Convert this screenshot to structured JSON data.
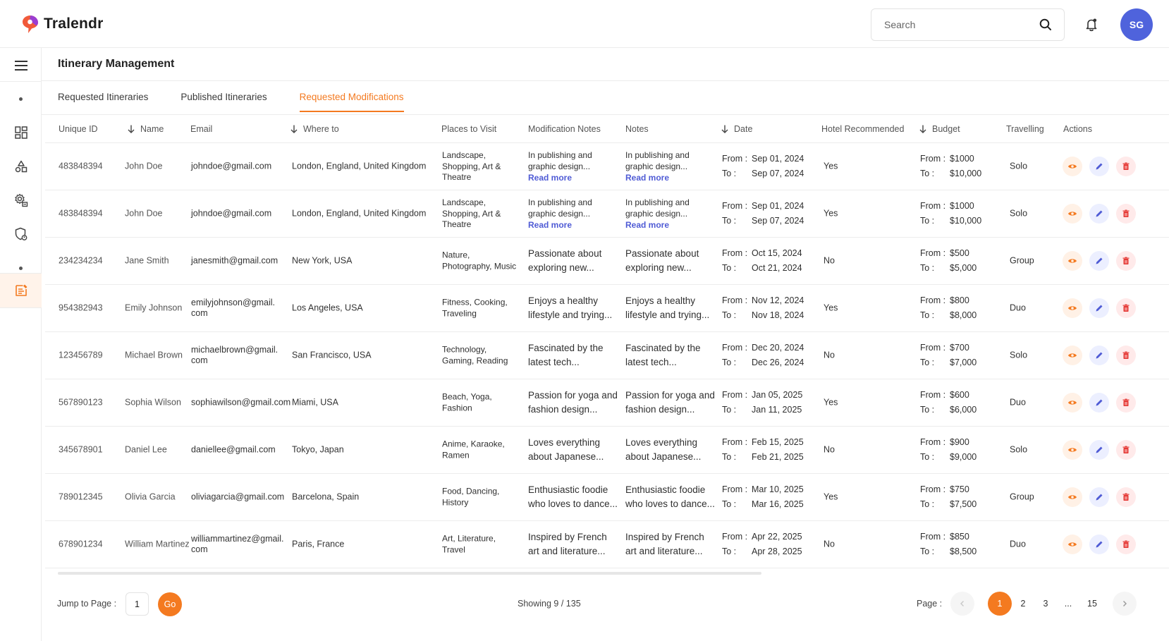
{
  "app": {
    "brand": "Tralendr"
  },
  "header": {
    "search_placeholder": "Search",
    "avatar_initials": "SG"
  },
  "page": {
    "title": "Itinerary Management",
    "tabs": [
      {
        "label": "Requested Itineraries",
        "active": false
      },
      {
        "label": "Published Itineraries",
        "active": false
      },
      {
        "label": "Requested Modifications",
        "active": true
      }
    ]
  },
  "sidebar": {
    "items": [
      {
        "icon": "menu-icon"
      },
      {
        "icon": "dot-icon"
      },
      {
        "icon": "dashboard-icon"
      },
      {
        "icon": "shapes-icon"
      },
      {
        "icon": "settings-icon"
      },
      {
        "icon": "shield-user-icon"
      },
      {
        "icon": "dot-icon"
      },
      {
        "icon": "itinerary-icon",
        "active": true
      }
    ]
  },
  "table": {
    "columns": {
      "id": "Unique ID",
      "name": "Name",
      "email": "Email",
      "where": "Where to",
      "places": "Places to Visit",
      "mod_notes": "Modification Notes",
      "notes": "Notes",
      "date": "Date",
      "hotel": "Hotel Recommended",
      "budget": "Budget",
      "travelling": "Travelling",
      "actions": "Actions"
    },
    "from_label": "From :",
    "to_label": "To :",
    "read_more": "Read more",
    "rows": [
      {
        "id": "483848394",
        "name": "John Doe",
        "email": "johndoe@gmail.com",
        "where": "London, England, United Kingdom",
        "places": "Landscape, Shopping, Art & Theatre",
        "mod_notes": "In publishing and graphic design...",
        "notes": "In publishing and graphic design...",
        "read_more": true,
        "date_from": "Sep 01, 2024",
        "date_to": "Sep 07, 2024",
        "hotel": "Yes",
        "budget_from": "$1000",
        "budget_to": "$10,000",
        "travelling": "Solo"
      },
      {
        "id": "483848394",
        "name": "John Doe",
        "email": "johndoe@gmail.com",
        "where": "London, England, United Kingdom",
        "places": "Landscape, Shopping, Art & Theatre",
        "mod_notes": "In publishing and graphic design...",
        "notes": "In publishing and graphic design...",
        "read_more": true,
        "date_from": "Sep 01, 2024",
        "date_to": "Sep 07, 2024",
        "hotel": "Yes",
        "budget_from": "$1000",
        "budget_to": "$10,000",
        "travelling": "Solo"
      },
      {
        "id": "234234234",
        "name": "Jane Smith",
        "email": "janesmith@gmail.com",
        "where": "New York, USA",
        "places": "Nature, Photography, Music",
        "mod_notes": "Passionate about exploring new...",
        "notes": "Passionate about exploring new...",
        "read_more": false,
        "date_from": "Oct 15, 2024",
        "date_to": "Oct 21, 2024",
        "hotel": "No",
        "budget_from": "$500",
        "budget_to": "$5,000",
        "travelling": "Group"
      },
      {
        "id": "954382943",
        "name": "Emily Johnson",
        "email": "emilyjohnson@gmail. com",
        "where": "Los Angeles, USA",
        "places": "Fitness, Cooking, Traveling",
        "mod_notes": "Enjoys a healthy lifestyle and trying...",
        "notes": "Enjoys a healthy lifestyle and trying...",
        "read_more": false,
        "date_from": "Nov 12, 2024",
        "date_to": "Nov 18, 2024",
        "hotel": "Yes",
        "budget_from": "$800",
        "budget_to": "$8,000",
        "travelling": "Duo"
      },
      {
        "id": "123456789",
        "name": "Michael Brown",
        "email": "michaelbrown@gmail. com",
        "where": "San Francisco, USA",
        "places": "Technology, Gaming, Reading",
        "mod_notes": "Fascinated by the latest tech...",
        "notes": "Fascinated by the latest tech...",
        "read_more": false,
        "date_from": "Dec 20, 2024",
        "date_to": "Dec 26, 2024",
        "hotel": "No",
        "budget_from": "$700",
        "budget_to": "$7,000",
        "travelling": "Solo"
      },
      {
        "id": "567890123",
        "name": "Sophia Wilson",
        "email": "sophiawilson@gmail.com",
        "where": "Miami, USA",
        "places": "Beach, Yoga, Fashion",
        "mod_notes": "Passion for yoga and fashion design...",
        "notes": "Passion for yoga and fashion design...",
        "read_more": false,
        "date_from": "Jan 05, 2025",
        "date_to": "Jan 11, 2025",
        "hotel": "Yes",
        "budget_from": "$600",
        "budget_to": "$6,000",
        "travelling": "Duo"
      },
      {
        "id": "345678901",
        "name": "Daniel Lee",
        "email": "daniellee@gmail.com",
        "where": "Tokyo, Japan",
        "places": "Anime, Karaoke, Ramen",
        "mod_notes": "Loves everything about Japanese...",
        "notes": "Loves everything about Japanese...",
        "read_more": false,
        "date_from": "Feb 15, 2025",
        "date_to": "Feb 21, 2025",
        "hotel": "No",
        "budget_from": "$900",
        "budget_to": "$9,000",
        "travelling": "Solo"
      },
      {
        "id": "789012345",
        "name": "Olivia Garcia",
        "email": "oliviagarcia@gmail.com",
        "where": "Barcelona, Spain",
        "places": "Food, Dancing, History",
        "mod_notes": "Enthusiastic foodie who loves to dance...",
        "notes": "Enthusiastic foodie who loves to dance...",
        "read_more": false,
        "date_from": "Mar 10, 2025",
        "date_to": "Mar 16, 2025",
        "hotel": "Yes",
        "budget_from": "$750",
        "budget_to": "$7,500",
        "travelling": "Group"
      },
      {
        "id": "678901234",
        "name": "William Martinez",
        "email": "williammartinez@gmail. com",
        "where": "Paris, France",
        "places": "Art, Literature, Travel",
        "mod_notes": "Inspired by French art and literature...",
        "notes": "Inspired by French art and literature...",
        "read_more": false,
        "date_from": "Apr 22, 2025",
        "date_to": "Apr 28, 2025",
        "hotel": "No",
        "budget_from": "$850",
        "budget_to": "$8,500",
        "travelling": "Duo"
      }
    ]
  },
  "footer": {
    "jump_label": "Jump to Page :",
    "jump_value": "1",
    "go_label": "Go",
    "showing": "Showing 9 / 135",
    "page_label": "Page :",
    "pages": [
      "1",
      "2",
      "3",
      "...",
      "15"
    ],
    "current_page": "1"
  },
  "colors": {
    "accent": "#f47a20",
    "avatar": "#4f63dc",
    "link": "#4f5bd5",
    "view_bg": "#fff1e6",
    "edit_bg": "#ecefff",
    "delete_bg": "#ffeaea"
  }
}
